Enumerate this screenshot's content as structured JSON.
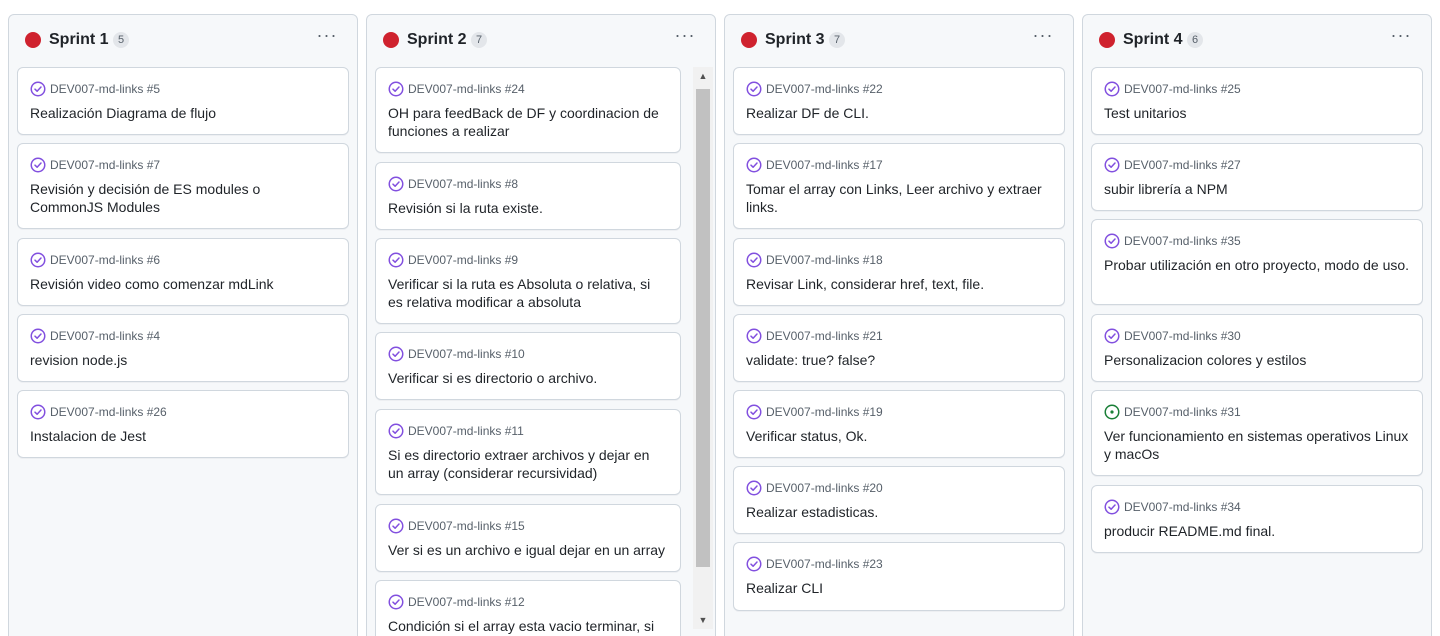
{
  "columns": [
    {
      "title": "Sprint 1",
      "count": "5",
      "cards": [
        {
          "ref": "DEV007-md-links #5",
          "title": "Realización Diagrama de flujo",
          "state": "closed"
        },
        {
          "ref": "DEV007-md-links #7",
          "title": "Revisión y decisión de ES modules o CommonJS Modules",
          "state": "closed"
        },
        {
          "ref": "DEV007-md-links #6",
          "title": "Revisión video como comenzar mdLink",
          "state": "closed"
        },
        {
          "ref": "DEV007-md-links #4",
          "title": "revision node.js",
          "state": "closed"
        },
        {
          "ref": "DEV007-md-links #26",
          "title": "Instalacion de Jest",
          "state": "closed"
        }
      ]
    },
    {
      "title": "Sprint 2",
      "count": "7",
      "cards": [
        {
          "ref": "DEV007-md-links #24",
          "title": "OH para feedBack de DF y coordinacion de funciones a realizar",
          "state": "closed"
        },
        {
          "ref": "DEV007-md-links #8",
          "title": "Revisión si la ruta existe.",
          "state": "closed"
        },
        {
          "ref": "DEV007-md-links #9",
          "title": "Verificar si la ruta es Absoluta o relativa, si es relativa modificar a absoluta",
          "state": "closed"
        },
        {
          "ref": "DEV007-md-links #10",
          "title": "Verificar si es directorio o archivo.",
          "state": "closed"
        },
        {
          "ref": "DEV007-md-links #11",
          "title": "Si es directorio extraer archivos y dejar en un array (considerar recursividad)",
          "state": "closed"
        },
        {
          "ref": "DEV007-md-links #15",
          "title": "Ver si es un archivo e igual dejar en un array",
          "state": "closed"
        },
        {
          "ref": "DEV007-md-links #12",
          "title": "Condición si el array esta vacio terminar, si",
          "state": "closed"
        }
      ]
    },
    {
      "title": "Sprint 3",
      "count": "7",
      "cards": [
        {
          "ref": "DEV007-md-links #22",
          "title": "Realizar DF de CLI.",
          "state": "closed"
        },
        {
          "ref": "DEV007-md-links #17",
          "title": "Tomar el array con Links, Leer archivo y extraer links.",
          "state": "closed"
        },
        {
          "ref": "DEV007-md-links #18",
          "title": "Revisar Link, considerar href, text, file.",
          "state": "closed"
        },
        {
          "ref": "DEV007-md-links #21",
          "title": "validate: true? false?",
          "state": "closed"
        },
        {
          "ref": "DEV007-md-links #19",
          "title": "Verificar status, Ok.",
          "state": "closed"
        },
        {
          "ref": "DEV007-md-links #20",
          "title": "Realizar estadisticas.",
          "state": "closed"
        },
        {
          "ref": "DEV007-md-links #23",
          "title": "Realizar CLI",
          "state": "closed"
        }
      ]
    },
    {
      "title": "Sprint 4",
      "count": "6",
      "cards": [
        {
          "ref": "DEV007-md-links #25",
          "title": "Test unitarios",
          "state": "closed"
        },
        {
          "ref": "DEV007-md-links #27",
          "title": "subir librería a NPM",
          "state": "closed"
        },
        {
          "ref": "DEV007-md-links #35",
          "title": "Probar utilización en otro proyecto, modo de uso.",
          "state": "closed"
        },
        {
          "ref": "DEV007-md-links #30",
          "title": "Personalizacion colores y estilos",
          "state": "closed"
        },
        {
          "ref": "DEV007-md-links #31",
          "title": "Ver funcionamiento en sistemas operativos Linux y macOs",
          "state": "open"
        },
        {
          "ref": "DEV007-md-links #34",
          "title": "producir README.md final.",
          "state": "closed"
        }
      ]
    }
  ],
  "icons": {
    "status_dot": "red-status-dot",
    "closed_issue": "check-circle-icon",
    "open_issue": "issue-opened-icon",
    "column_menu": "kebab-horizontal-icon"
  },
  "colors": {
    "status_red": "#cf222e",
    "closed_purple": "#8250df",
    "open_green": "#1a7f37",
    "column_bg": "#f6f8fa",
    "border": "#d0d7de"
  }
}
